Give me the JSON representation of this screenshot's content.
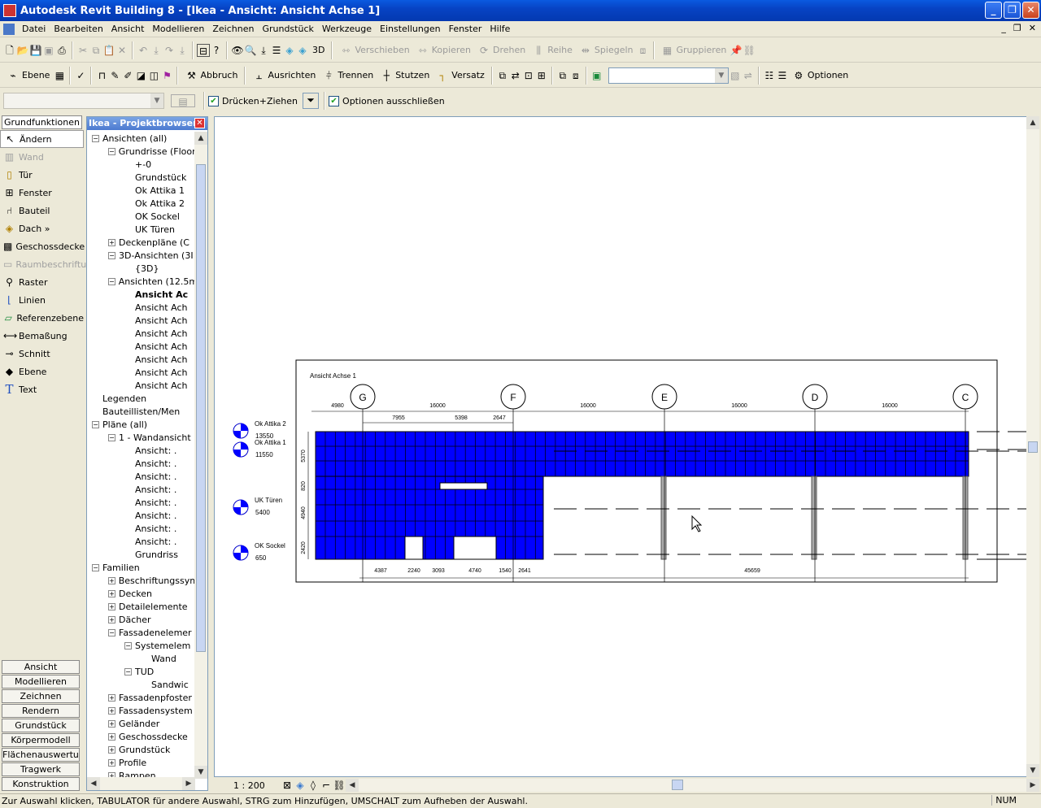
{
  "window": {
    "title": "Autodesk Revit Building 8 - [Ikea - Ansicht: Ansicht Achse 1]"
  },
  "menu": [
    "Datei",
    "Bearbeiten",
    "Ansicht",
    "Modellieren",
    "Zeichnen",
    "Grundstück",
    "Werkzeuge",
    "Einstellungen",
    "Fenster",
    "Hilfe"
  ],
  "toolbar1": {
    "view3d_label": "3D",
    "move": "Verschieben",
    "copy": "Kopieren",
    "rotate": "Drehen",
    "array": "Reihe",
    "mirror": "Spiegeln",
    "group": "Gruppieren"
  },
  "toolbar2": {
    "level": "Ebene",
    "abort": "Abbruch",
    "align": "Ausrichten",
    "split": "Trennen",
    "trim": "Stutzen",
    "offset": "Versatz",
    "options": "Optionen"
  },
  "optionsbar": {
    "drag_label": "Drücken+Ziehen",
    "exclude_label": "Optionen ausschließen"
  },
  "tools": {
    "header": "Grundfunktionen",
    "items": [
      "Ändern",
      "Wand",
      "Tür",
      "Fenster",
      "Bauteil",
      "Dach »",
      "Geschossdecke",
      "Raumbeschriftu",
      "Raster",
      "Linien",
      "Referenzebene",
      "Bemaßung",
      "Schnitt",
      "Ebene",
      "Text"
    ],
    "tabs": [
      "Ansicht",
      "Modellieren",
      "Zeichnen",
      "Rendern",
      "Grundstück",
      "Körpermodell",
      "Flächenauswertung",
      "Tragwerk",
      "Konstruktion"
    ]
  },
  "browser": {
    "title": "Ikea - Projektbrowser",
    "nodes": [
      {
        "label": "Ansichten (all)",
        "indent": 0,
        "pm": "-"
      },
      {
        "label": "Grundrisse (Floor",
        "indent": 1,
        "pm": "-"
      },
      {
        "label": "+-0",
        "indent": 2
      },
      {
        "label": "Grundstück",
        "indent": 2
      },
      {
        "label": "Ok Attika 1",
        "indent": 2
      },
      {
        "label": "Ok Attika 2",
        "indent": 2
      },
      {
        "label": "OK Sockel",
        "indent": 2
      },
      {
        "label": "UK Türen",
        "indent": 2
      },
      {
        "label": "Deckenpläne (C",
        "indent": 1,
        "pm": "+"
      },
      {
        "label": "3D-Ansichten (3I",
        "indent": 1,
        "pm": "-"
      },
      {
        "label": "{3D}",
        "indent": 2
      },
      {
        "label": "Ansichten (12.5m",
        "indent": 1,
        "pm": "-"
      },
      {
        "label": "Ansicht Ac",
        "indent": 2,
        "bold": true
      },
      {
        "label": "Ansicht Ach",
        "indent": 2
      },
      {
        "label": "Ansicht Ach",
        "indent": 2
      },
      {
        "label": "Ansicht Ach",
        "indent": 2
      },
      {
        "label": "Ansicht Ach",
        "indent": 2
      },
      {
        "label": "Ansicht Ach",
        "indent": 2
      },
      {
        "label": "Ansicht Ach",
        "indent": 2
      },
      {
        "label": "Ansicht Ach",
        "indent": 2
      },
      {
        "label": "Legenden",
        "indent": 0
      },
      {
        "label": "Bauteillisten/Men",
        "indent": 0
      },
      {
        "label": "Pläne (all)",
        "indent": 0,
        "pm": "-"
      },
      {
        "label": "1 - Wandansicht",
        "indent": 1,
        "pm": "-"
      },
      {
        "label": "Ansicht: .",
        "indent": 2
      },
      {
        "label": "Ansicht: .",
        "indent": 2
      },
      {
        "label": "Ansicht: .",
        "indent": 2
      },
      {
        "label": "Ansicht: .",
        "indent": 2
      },
      {
        "label": "Ansicht: .",
        "indent": 2
      },
      {
        "label": "Ansicht: .",
        "indent": 2
      },
      {
        "label": "Ansicht: .",
        "indent": 2
      },
      {
        "label": "Ansicht: .",
        "indent": 2
      },
      {
        "label": "Grundriss",
        "indent": 2
      },
      {
        "label": "Familien",
        "indent": 0,
        "pm": "-"
      },
      {
        "label": "Beschriftungssym",
        "indent": 1,
        "pm": "+"
      },
      {
        "label": "Decken",
        "indent": 1,
        "pm": "+"
      },
      {
        "label": "Detailelemente",
        "indent": 1,
        "pm": "+"
      },
      {
        "label": "Dächer",
        "indent": 1,
        "pm": "+"
      },
      {
        "label": "Fassadenelemer",
        "indent": 1,
        "pm": "-"
      },
      {
        "label": "Systemelem",
        "indent": 2,
        "pm": "-"
      },
      {
        "label": "Wand",
        "indent": 3
      },
      {
        "label": "TUD",
        "indent": 2,
        "pm": "-"
      },
      {
        "label": "Sandwic",
        "indent": 3
      },
      {
        "label": "Fassadenpfoster",
        "indent": 1,
        "pm": "+"
      },
      {
        "label": "Fassadensystem",
        "indent": 1,
        "pm": "+"
      },
      {
        "label": "Geländer",
        "indent": 1,
        "pm": "+"
      },
      {
        "label": "Geschossdecke",
        "indent": 1,
        "pm": "+"
      },
      {
        "label": "Grundstück",
        "indent": 1,
        "pm": "+"
      },
      {
        "label": "Profile",
        "indent": 1,
        "pm": "+"
      },
      {
        "label": "Rampen",
        "indent": 1,
        "pm": "+"
      }
    ]
  },
  "drawing": {
    "view_title": "Ansicht Achse 1",
    "grids": [
      "G",
      "F",
      "E",
      "D",
      "C"
    ],
    "top_dims": [
      "4980",
      "16000",
      "16000",
      "16000",
      "16000"
    ],
    "sub_dims": [
      "7955",
      "5398",
      "2647"
    ],
    "levels": [
      {
        "name": "Ok Attika 2",
        "value": "13550"
      },
      {
        "name": "Ok Attika 1",
        "value": "11550"
      },
      {
        "name": "UK Türen",
        "value": "5400"
      },
      {
        "name": "OK Sockel",
        "value": "650"
      }
    ],
    "vert_dims": [
      "5370",
      "820",
      "4940",
      "2420"
    ],
    "bottom_dims": [
      "4387",
      "2240",
      "3093",
      "4740",
      "1540",
      "2641",
      "45659"
    ],
    "wall_color": "#0000ff"
  },
  "canvas_status": {
    "scale": "1 : 200"
  },
  "status": {
    "text": "Zur Auswahl klicken, TABULATOR für andere Auswahl, STRG zum Hinzufügen, UMSCHALT zum Aufheben der Auswahl.",
    "num": "NUM"
  }
}
